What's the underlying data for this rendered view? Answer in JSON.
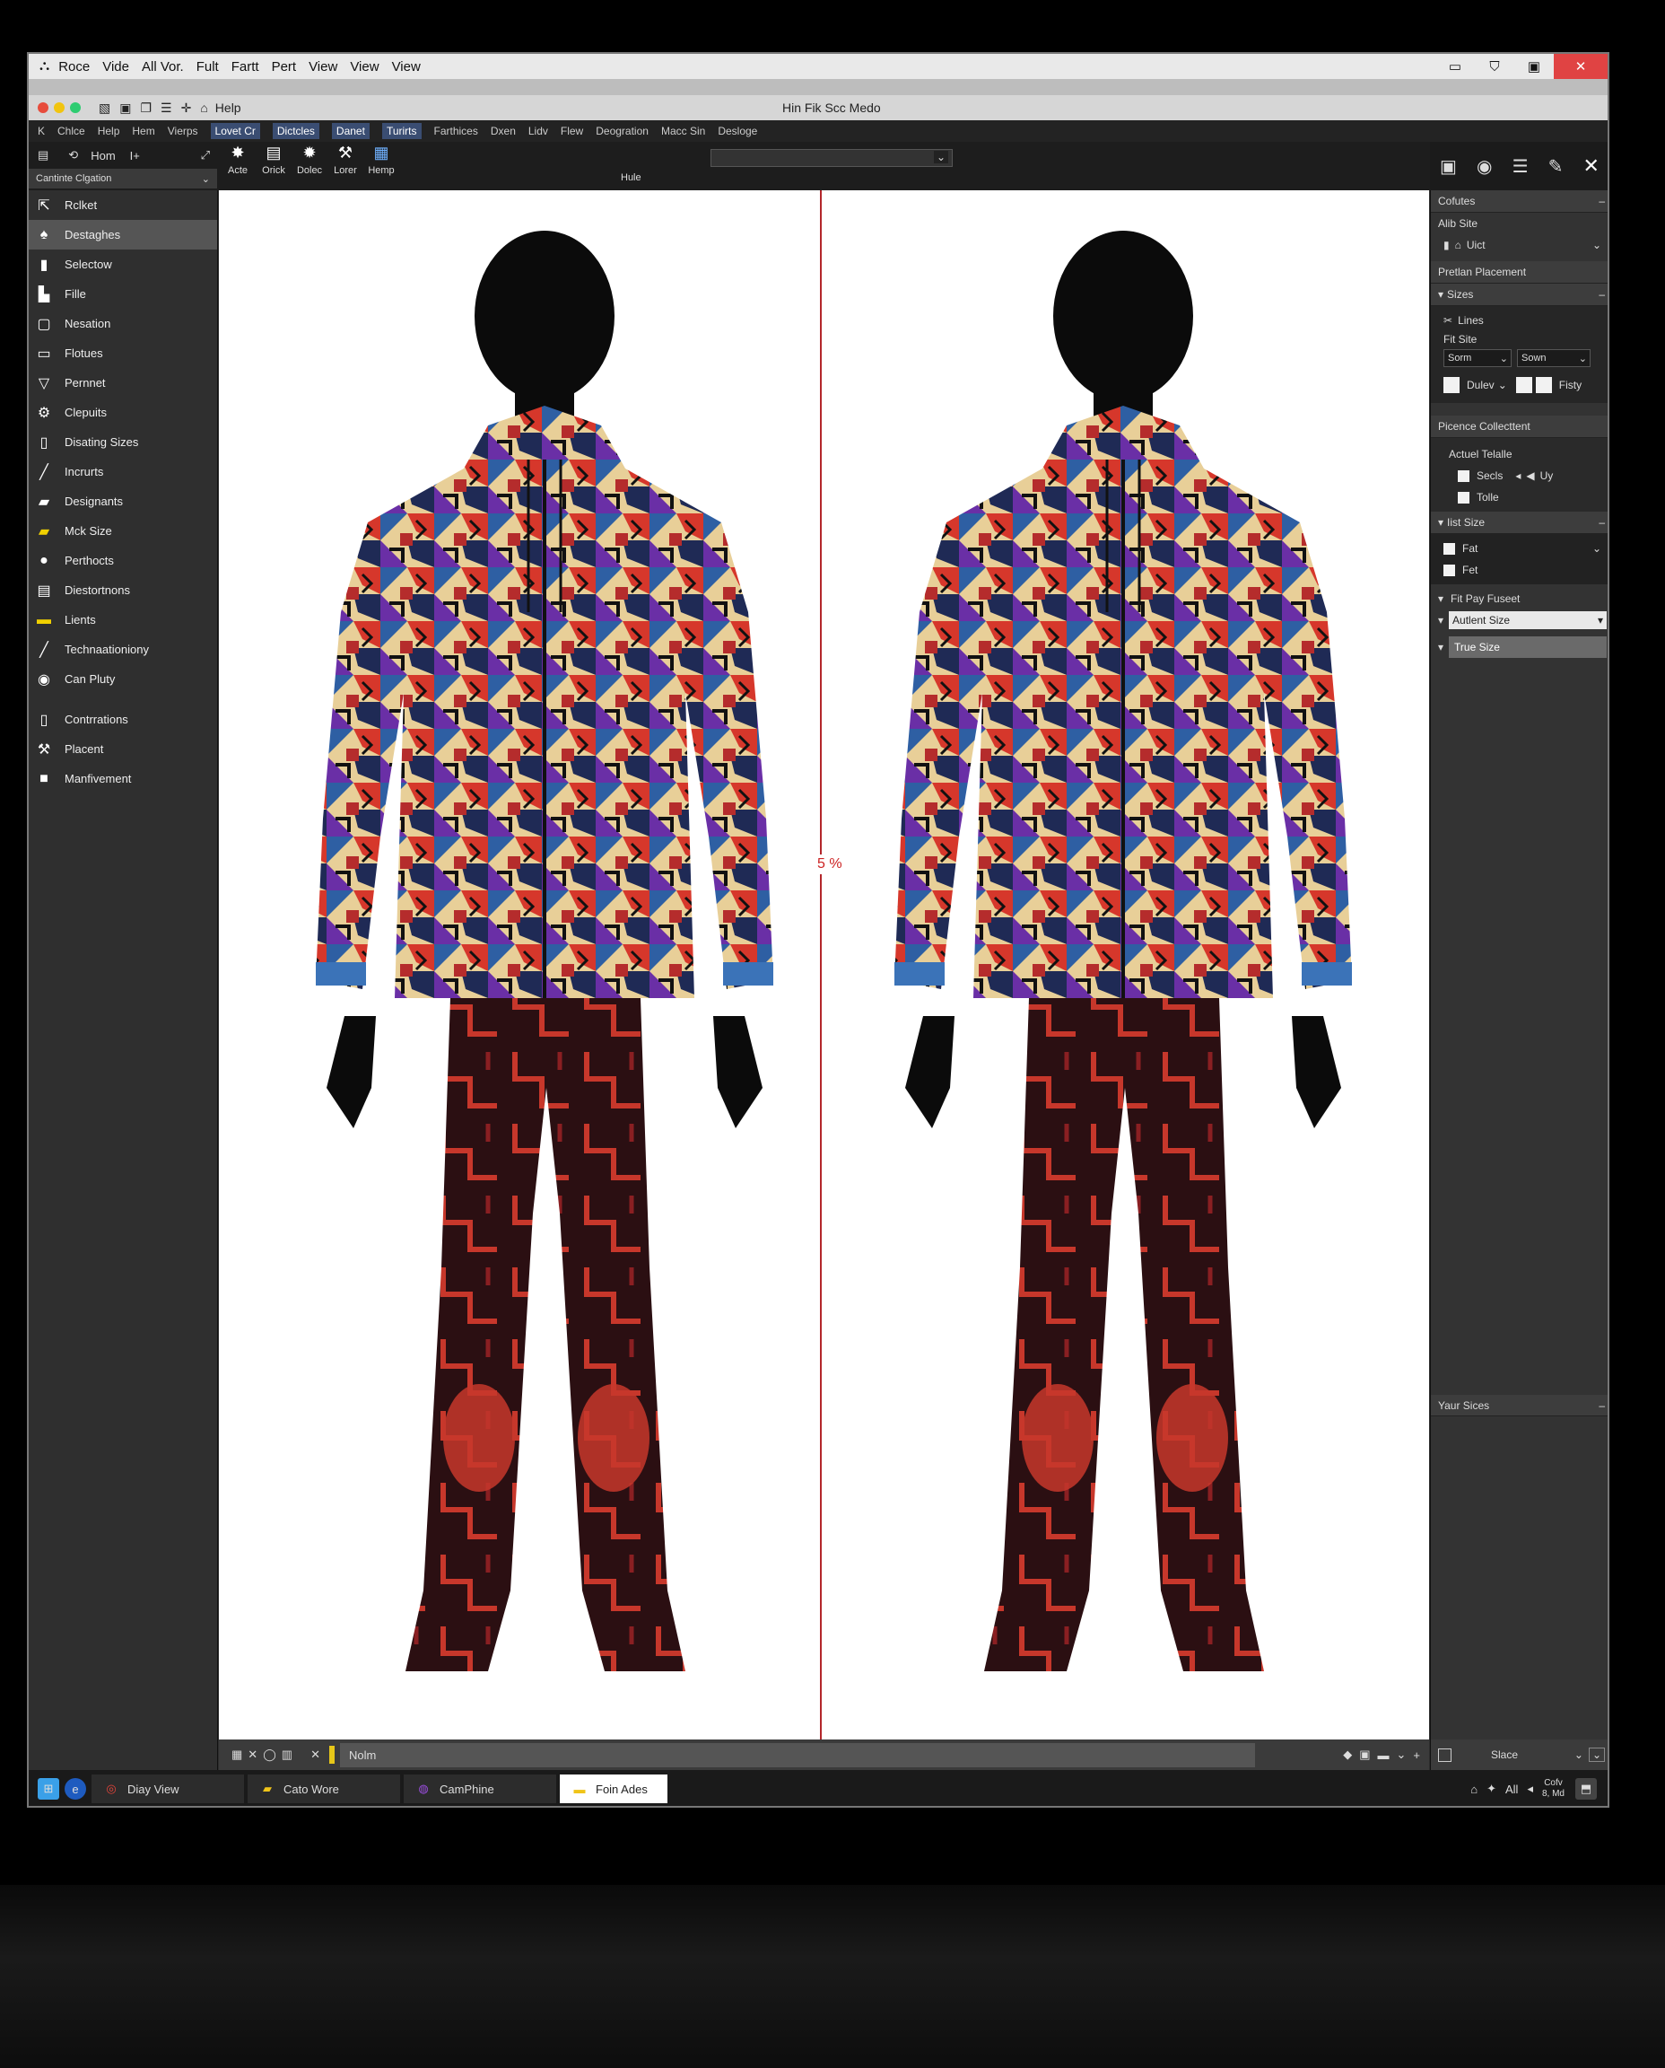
{
  "window": {
    "menu": [
      "Roce",
      "Vide",
      "All Vor.",
      "Fult",
      "Fartt",
      "Pert",
      "View",
      "View",
      "View"
    ],
    "controls": [
      "▭",
      "⛉",
      "▣",
      "✕"
    ]
  },
  "app_bar": {
    "help_label": "Help",
    "title": "Hin Fik Scc Medo"
  },
  "menu_bar": {
    "items": [
      "K",
      "Chlce",
      "Help",
      "Hem",
      "Vierps",
      "Lovet Cr",
      "Dictcles",
      "Danet",
      "Turirts",
      "Farthices",
      "Dxen",
      "Lidv",
      "Flew",
      "Deogration",
      "Macc Sin",
      "Desloge"
    ]
  },
  "toolbar": {
    "hom_label": "Hom",
    "plus_label": "I+",
    "tools": [
      "Acte",
      "Orick",
      "Dolec",
      "Lorer",
      "Hemp"
    ],
    "hule_label": "Hule",
    "dropdown_value": ""
  },
  "left_panel": {
    "title": "Cantinte Clgation",
    "items": [
      {
        "label": "Rclket",
        "icon": "pointer-icon"
      },
      {
        "label": "Destaghes",
        "icon": "dress-icon",
        "selected": true
      },
      {
        "label": "Selectow",
        "icon": "select-icon"
      },
      {
        "label": "Fille",
        "icon": "fill-icon"
      },
      {
        "label": "Nesation",
        "icon": "frame-icon"
      },
      {
        "label": "Flotues",
        "icon": "square-icon"
      },
      {
        "label": "Pernnet",
        "icon": "cup-icon"
      },
      {
        "label": "Clepuits",
        "icon": "gear-icon"
      },
      {
        "label": "Disating Sizes",
        "icon": "page-icon"
      },
      {
        "label": "Incrurts",
        "icon": "pen-icon"
      },
      {
        "label": "Designants",
        "icon": "folder-icon"
      },
      {
        "label": "Mck Size",
        "icon": "yellow-folder-icon"
      },
      {
        "label": "Perthocts",
        "icon": "person-icon"
      },
      {
        "label": "Diestortnons",
        "icon": "layers-icon"
      },
      {
        "label": "Lients",
        "icon": "note-icon"
      },
      {
        "label": "Technaationiony",
        "icon": "brush-icon"
      },
      {
        "label": "Can Pluty",
        "icon": "drop-icon"
      },
      {
        "label": "Contrrations",
        "icon": "doc-icon"
      },
      {
        "label": "Placent",
        "icon": "hammer-icon"
      },
      {
        "label": "Manfivement",
        "icon": "white-square-icon"
      }
    ]
  },
  "right_panel": {
    "section1_title": "Cofutes",
    "alt_size_label": "Alib Site",
    "lock_label": "Uict",
    "placement_label": "Pretlan Placement",
    "sizes_label": "Sizes",
    "lines_label": "Lines",
    "fit_site_label": "Fit Site",
    "select1": "Sorm",
    "select2": "Sown",
    "dulev_label": "Dulev",
    "fisty_label": "Fisty",
    "collection_label": "Picence Collecttent",
    "actual_table_label": "Actuel Telalle",
    "check1": "Secls",
    "check1_extra": "Uy",
    "check2": "Tolle",
    "list_size_label": "Iist Size",
    "fat1": "Fat",
    "fat2": "Fet",
    "fit_preset_label": "Fit Pay Fuseet",
    "autent_size": "Autlent Size",
    "true_size": "True Size",
    "your_sizes_label": "Yaur Sices",
    "slace_label": "Slace"
  },
  "canvas": {
    "percent_label": "5 %",
    "colors": {
      "hoodie_blue": "#2e5fa3",
      "hoodie_red": "#d6372b",
      "hoodie_purple": "#6a2fa6",
      "hoodie_cream": "#e8cf98",
      "pants_dark": "#2b0f12",
      "pants_red": "#c7372b"
    }
  },
  "status_bar": {
    "tab_label": "Nolm",
    "icons": [
      "grid-icon",
      "cross-icon",
      "circle-icon",
      "film-icon"
    ]
  },
  "taskbar": {
    "items": [
      {
        "label": "Diay View",
        "icon": "browser-icon"
      },
      {
        "label": "Cato Wore",
        "icon": "folder-icon"
      },
      {
        "label": "CamPhine",
        "icon": "app-icon"
      },
      {
        "label": "Foin Ades",
        "icon": "note-icon",
        "active": true
      }
    ],
    "tray_text": "All",
    "clock_line1": "Cofv",
    "clock_line2": "8, Md"
  }
}
